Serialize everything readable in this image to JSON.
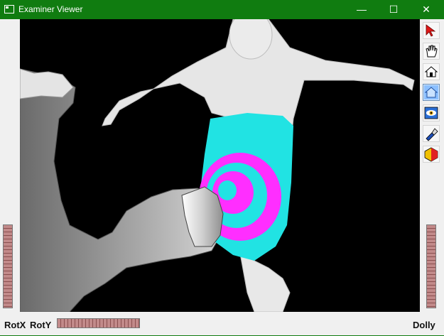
{
  "window": {
    "title": "Examiner Viewer",
    "minimize_icon": "—",
    "maximize_icon": "☐",
    "close_icon": "✕"
  },
  "toolbar": {
    "items": [
      {
        "name": "select-arrow-icon",
        "active": false
      },
      {
        "name": "hand-icon",
        "active": false
      },
      {
        "name": "home-icon",
        "active": false
      },
      {
        "name": "set-home-icon",
        "active": true
      },
      {
        "name": "view-all-icon",
        "active": false
      },
      {
        "name": "flashlight-icon",
        "active": false
      },
      {
        "name": "perspective-icon",
        "active": false
      }
    ]
  },
  "bottom": {
    "rotx_label": "RotX",
    "roty_label": "RotY",
    "dolly_label": "Dolly"
  }
}
